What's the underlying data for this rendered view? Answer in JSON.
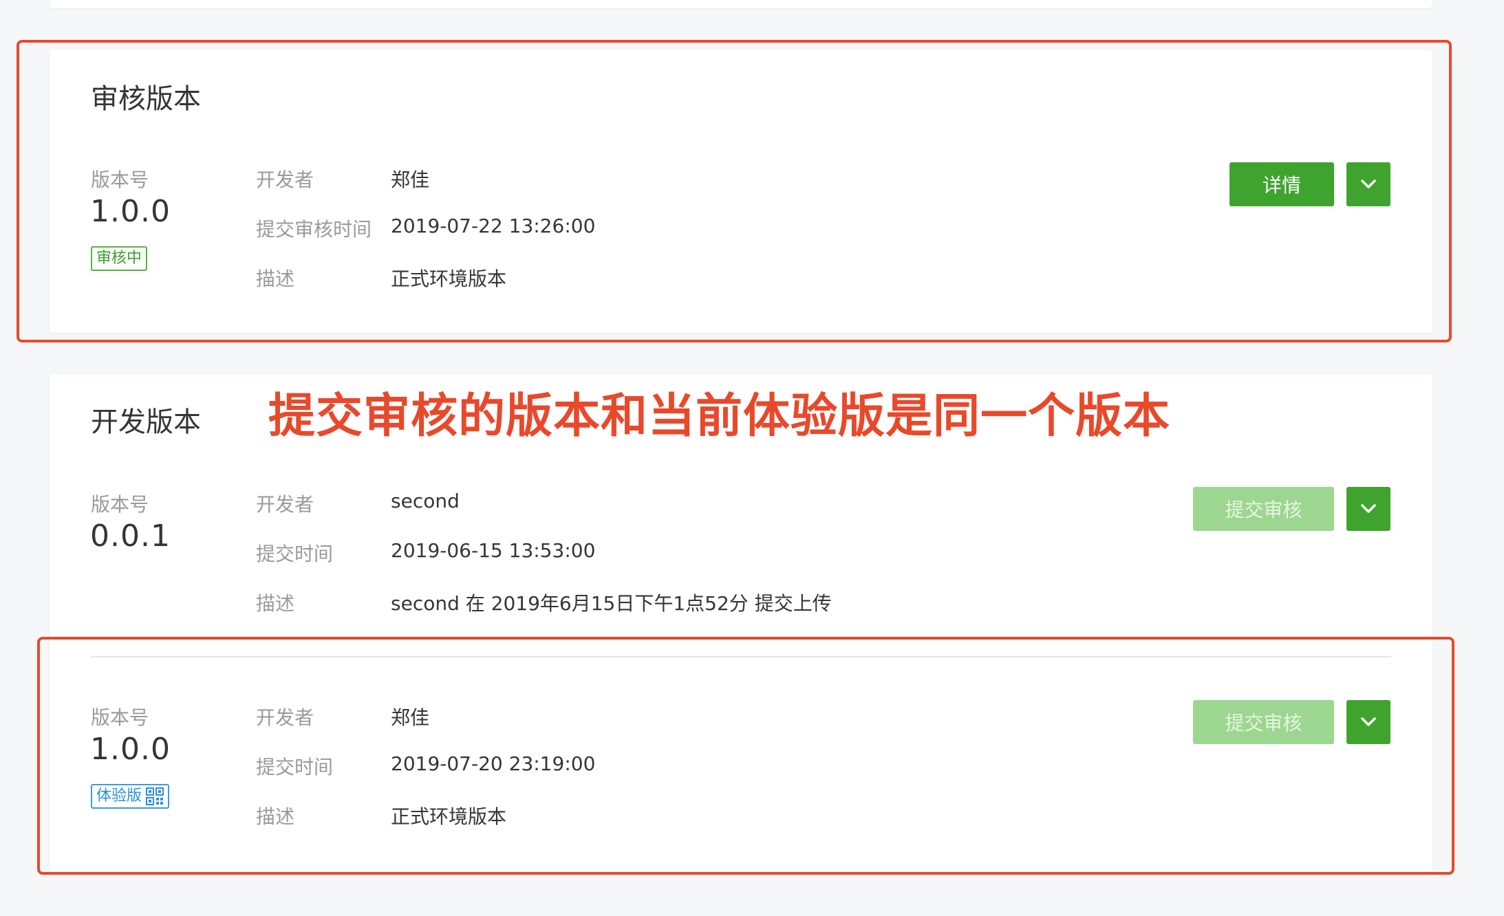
{
  "review": {
    "title": "审核版本",
    "version_label": "版本号",
    "version": "1.0.0",
    "status_tag": "审核中",
    "rows": [
      {
        "key": "开发者",
        "value": "郑佳"
      },
      {
        "key": "提交审核时间",
        "value": "2019-07-22 13:26:00"
      },
      {
        "key": "描述",
        "value": "正式环境版本"
      }
    ],
    "detail_button": "详情"
  },
  "dev": {
    "title": "开发版本",
    "versions": [
      {
        "version_label": "版本号",
        "version": "0.0.1",
        "rows": [
          {
            "key": "开发者",
            "value": "second"
          },
          {
            "key": "提交时间",
            "value": "2019-06-15 13:53:00"
          },
          {
            "key": "描述",
            "value": "second 在 2019年6月15日下午1点52分 提交上传"
          }
        ],
        "submit_button": "提交审核"
      },
      {
        "version_label": "版本号",
        "version": "1.0.0",
        "tag": "体验版",
        "rows": [
          {
            "key": "开发者",
            "value": "郑佳"
          },
          {
            "key": "提交时间",
            "value": "2019-07-20 23:19:00"
          },
          {
            "key": "描述",
            "value": "正式环境版本"
          }
        ],
        "submit_button": "提交审核"
      }
    ]
  },
  "annotation": {
    "text": "提交审核的版本和当前体验版是同一个版本",
    "color": "#e8492b"
  },
  "colors": {
    "primary_green": "#3fa42e",
    "disabled_green": "#9dd690",
    "tag_blue": "#2b8ede",
    "muted_text": "#9a9a9a"
  }
}
